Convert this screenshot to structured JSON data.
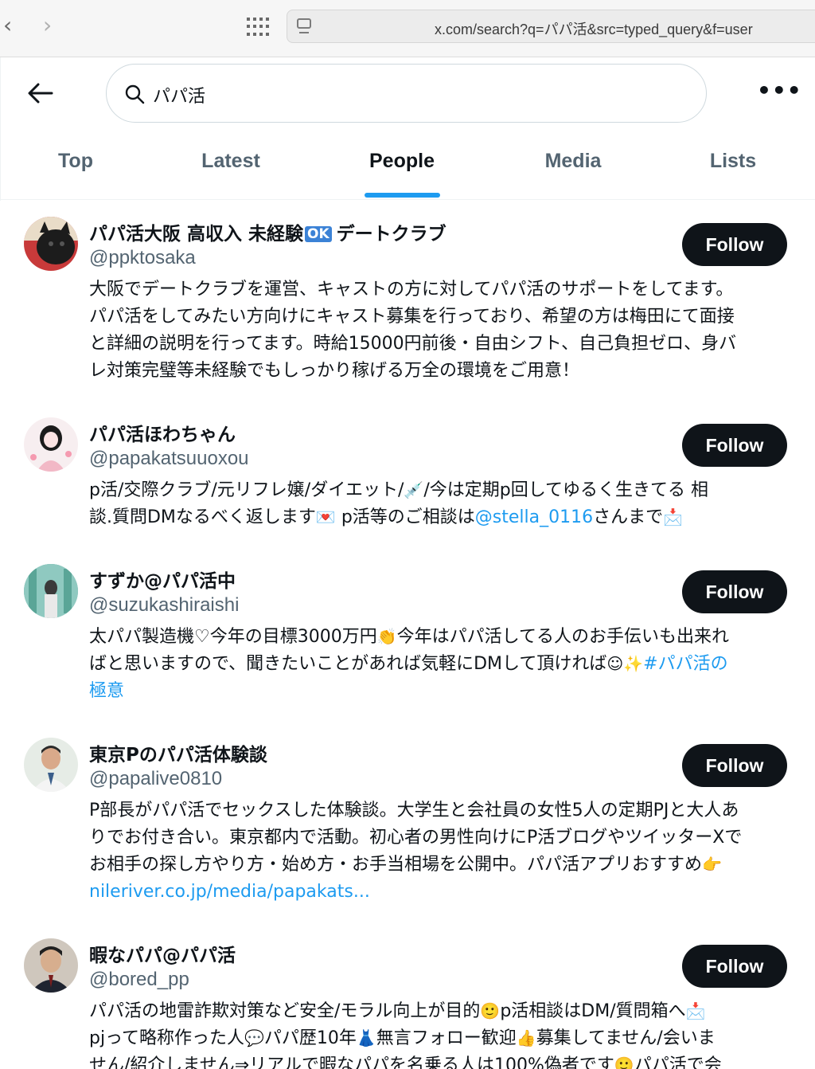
{
  "browser": {
    "back_glyph": "‹",
    "forward_glyph": "›",
    "url": "x.com/search?q=パパ活&src=typed_query&f=user"
  },
  "header": {
    "search_value": "パパ活",
    "tabs": [
      {
        "label": "Top"
      },
      {
        "label": "Latest"
      },
      {
        "label": "People"
      },
      {
        "label": "Media"
      },
      {
        "label": "Lists"
      }
    ],
    "active_tab": "People",
    "more_glyph": "•••"
  },
  "colors": {
    "accent": "#1d9bf0",
    "follow_button": "#0f1419",
    "secondary_text": "#536471"
  },
  "follow_label": "Follow",
  "users": [
    {
      "name_pre": "パパ活大阪 高収入 未経験",
      "name_badge": "OK",
      "name_post": "デートクラブ",
      "handle": "@ppktosaka",
      "bio_lines": [
        "大阪でデートクラブを運営、キャストの方に対してパパ活のサポートをしてます。",
        "パパ活をしてみたい方向けにキャスト募集を行っており、希望の方は梅田にて面接",
        "と詳細の説明を行ってます。時給15000円前後・自由シフト、自己負担ゼロ、身バ",
        "レ対策完璧等未経験でもしっかり稼げる万全の環境をご用意！"
      ]
    },
    {
      "name": "パパ活ほわちゃん",
      "handle": "@papakatsuuoxou",
      "bio_l1": "p活/交際クラブ/元リフレ嬢/ダイエット/",
      "bio_l1_emoji": "💉",
      "bio_l1_post": "/今は定期p回してゆるく生きてる 相",
      "bio_l2_pre": "談.質問DMなるべく返します",
      "bio_l2_emoji": "💌",
      "bio_l2_mid": " p活等のご相談は",
      "bio_l2_link": "@stella_0116",
      "bio_l2_post": "さんまで",
      "bio_l2_emoji2": "📩"
    },
    {
      "name": "すずか@パパ活中",
      "handle": "@suzukashiraishi",
      "bio_l1_pre": "太パパ製造機♡今年の目標3000万円",
      "bio_l1_emoji": "👏",
      "bio_l1_post": "今年はパパ活してる人のお手伝いも出来れ",
      "bio_l2_pre": "ばと思いますので、聞きたいことがあれば気軽にDMして頂ければ",
      "bio_l2_emoji": "☺",
      "bio_l2_emoji2": "✨",
      "bio_l2_link": "#パパ活の",
      "bio_l3_link": "極意"
    },
    {
      "name": "東京Pのパパ活体験談",
      "handle": "@papalive0810",
      "bio_lines": [
        "P部長がパパ活でセックスした体験談。大学生と会社員の女性5人の定期PJと大人あ",
        "りでお付き合い。東京都内で活動。初心者の男性向けにP活ブログやツイッターXで"
      ],
      "bio_l3": "お相手の探し方やり方・始め方・お手当相場を公開中。パパ活アプリおすすめ",
      "bio_l3_emoji": "👉",
      "bio_link": "nileriver.co.jp/media/papakats..."
    },
    {
      "name": "暇なパパ@パパ活",
      "handle": "@bored_pp",
      "bio_l1_pre": "パパ活の地雷詐欺対策など安全/モラル向上が目的",
      "bio_l1_emoji": "🙂",
      "bio_l1_post": "p活相談はDM/質問箱へ",
      "bio_l1_emoji2": "📩",
      "bio_l2_pre": "pjって略称作った人",
      "bio_l2_emoji": "💬",
      "bio_l2_mid": "パパ歴10年",
      "bio_l2_emoji2": "👗",
      "bio_l2_mid2": "無言フォロー歓迎",
      "bio_l2_emoji3": "👍",
      "bio_l2_post": "募集してません/会いま",
      "bio_l3": "せん/紹介しません⇒リアルで暇なパパを名乗る人は100%偽者です",
      "bio_l3_emoji": "🙂",
      "bio_l3_post": "パパ活で会"
    }
  ]
}
